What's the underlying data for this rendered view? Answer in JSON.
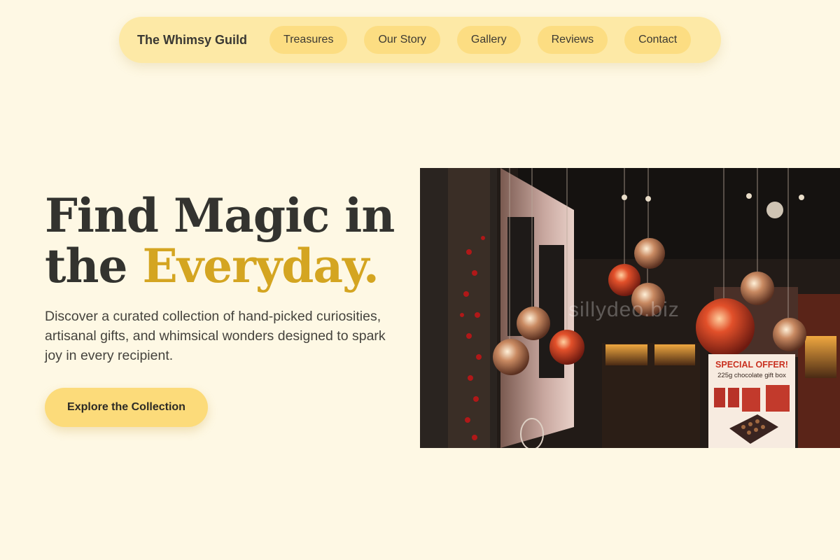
{
  "nav": {
    "brand": "The Whimsy Guild",
    "links": [
      "Treasures",
      "Our Story",
      "Gallery",
      "Reviews",
      "Contact"
    ]
  },
  "hero": {
    "title_line1": "Find Magic in",
    "title_line2_prefix": "the ",
    "title_accent": "Everyday.",
    "description": "Discover a curated collection of hand-picked curiosities, artisanal gifts, and whimsical wonders designed to spark joy in every recipient.",
    "cta_label": "Explore the Collection"
  },
  "image": {
    "watermark": "sillydeo.biz",
    "offer_title": "SPECIAL OFFER!",
    "offer_sub": "225g chocolate gift box"
  },
  "colors": {
    "background": "#fef8e4",
    "nav_bg": "#fde9a6",
    "pill_bg": "#fcdd82",
    "accent": "#d4a521",
    "text": "#33332f"
  }
}
